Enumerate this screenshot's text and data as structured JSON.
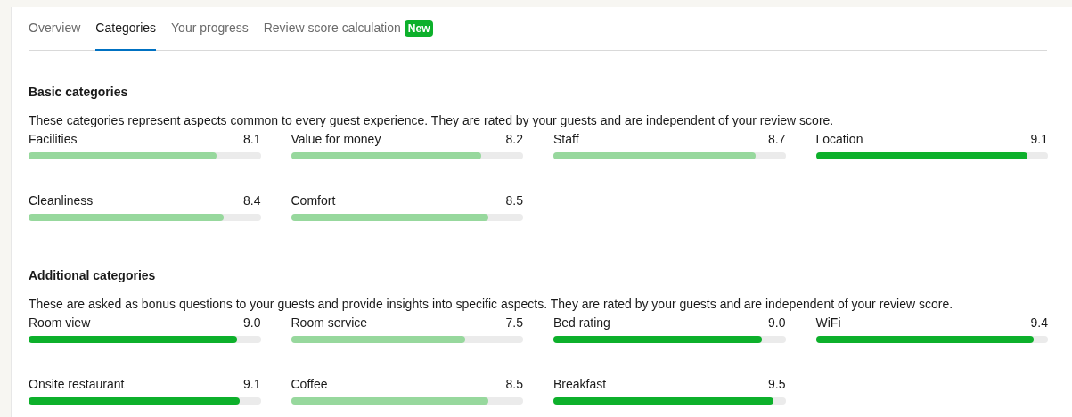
{
  "tabs": [
    {
      "label": "Overview",
      "selected": false
    },
    {
      "label": "Categories",
      "selected": true
    },
    {
      "label": "Your progress",
      "selected": false
    },
    {
      "label": "Review score calculation",
      "selected": false,
      "badge": "New"
    }
  ],
  "sections": [
    {
      "title": "Basic categories",
      "description": "These categories represent aspects common to every guest experience. They are rated by your guests and are independent of your review score.",
      "categories": [
        {
          "name": "Facilities",
          "score": "8.1",
          "level": 0.81,
          "color": "#97d89d"
        },
        {
          "name": "Value for money",
          "score": "8.2",
          "level": 0.82,
          "color": "#97d89d"
        },
        {
          "name": "Staff",
          "score": "8.7",
          "level": 0.87,
          "color": "#97d89d"
        },
        {
          "name": "Location",
          "score": "9.1",
          "level": 0.91,
          "color": "#0db02b"
        },
        {
          "name": "Cleanliness",
          "score": "8.4",
          "level": 0.84,
          "color": "#97d89d"
        },
        {
          "name": "Comfort",
          "score": "8.5",
          "level": 0.85,
          "color": "#97d89d"
        }
      ]
    },
    {
      "title": "Additional categories",
      "description": "These are asked as bonus questions to your guests and provide insights into specific aspects. They are rated by your guests and are independent of your review score.",
      "categories": [
        {
          "name": "Room view",
          "score": "9.0",
          "level": 0.9,
          "color": "#0db02b"
        },
        {
          "name": "Room service",
          "score": "7.5",
          "level": 0.75,
          "color": "#97d89d"
        },
        {
          "name": "Bed rating",
          "score": "9.0",
          "level": 0.9,
          "color": "#0db02b"
        },
        {
          "name": "WiFi",
          "score": "9.4",
          "level": 0.94,
          "color": "#0db02b"
        },
        {
          "name": "Onsite restaurant",
          "score": "9.1",
          "level": 0.91,
          "color": "#0db02b"
        },
        {
          "name": "Coffee",
          "score": "8.5",
          "level": 0.85,
          "color": "#97d89d"
        },
        {
          "name": "Breakfast",
          "score": "9.5",
          "level": 0.95,
          "color": "#0db02b"
        }
      ]
    }
  ]
}
